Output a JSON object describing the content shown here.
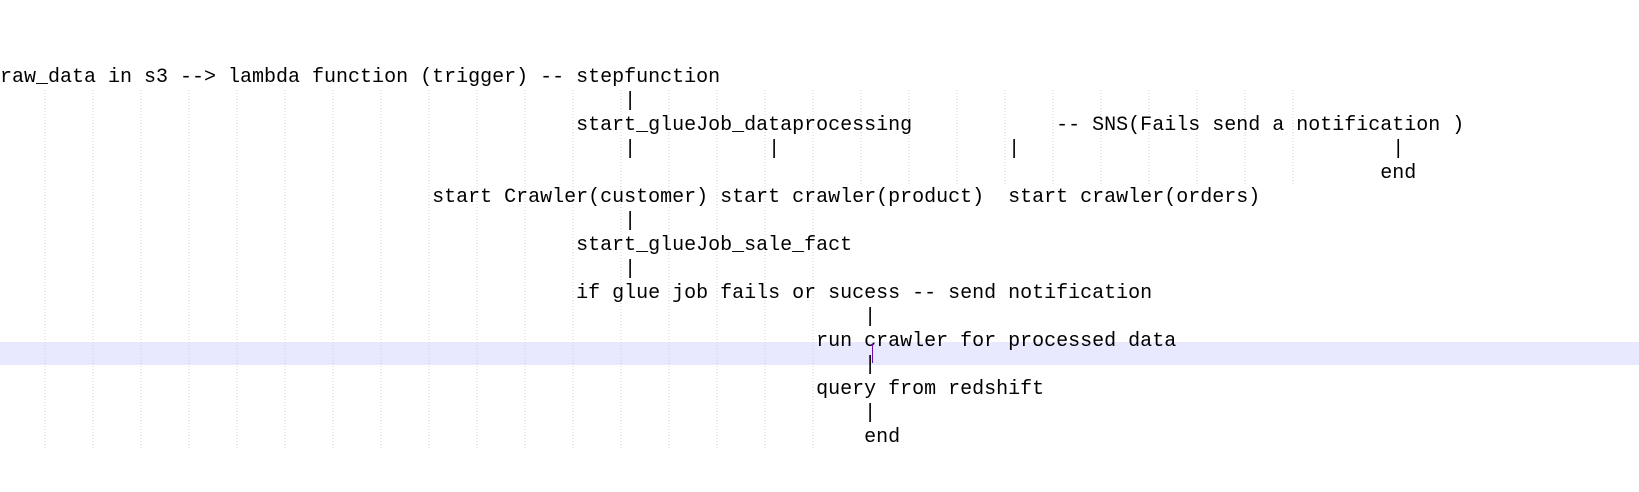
{
  "editor": {
    "colors": {
      "background": "#ffffff",
      "text": "#000000",
      "current_line_highlight": "#e8e8ff",
      "indent_guide": "#d0d0d0",
      "caret": "#6a0dad"
    },
    "lines": [
      "",
      "",
      "raw_data in s3 --> lambda function (trigger) -- stepfunction",
      "                                                    |",
      "                                                start_glueJob_dataprocessing            -- SNS(Fails send a notification )",
      "                                                    |           |                   |                               |",
      "                                                                                                                   end",
      "                                    start Crawler(customer) start crawler(product)  start crawler(orders)",
      "                                                    |",
      "                                                start_glueJob_sale_fact",
      "                                                    |",
      "                                                if glue job fails or sucess -- send notification",
      "                                                                        |",
      "                                                                    run crawler for processed data",
      "                                                                        |",
      "                                                                    query from redshift",
      "                                                                        |",
      "                                                                        end"
    ],
    "current_line_index": 14
  }
}
